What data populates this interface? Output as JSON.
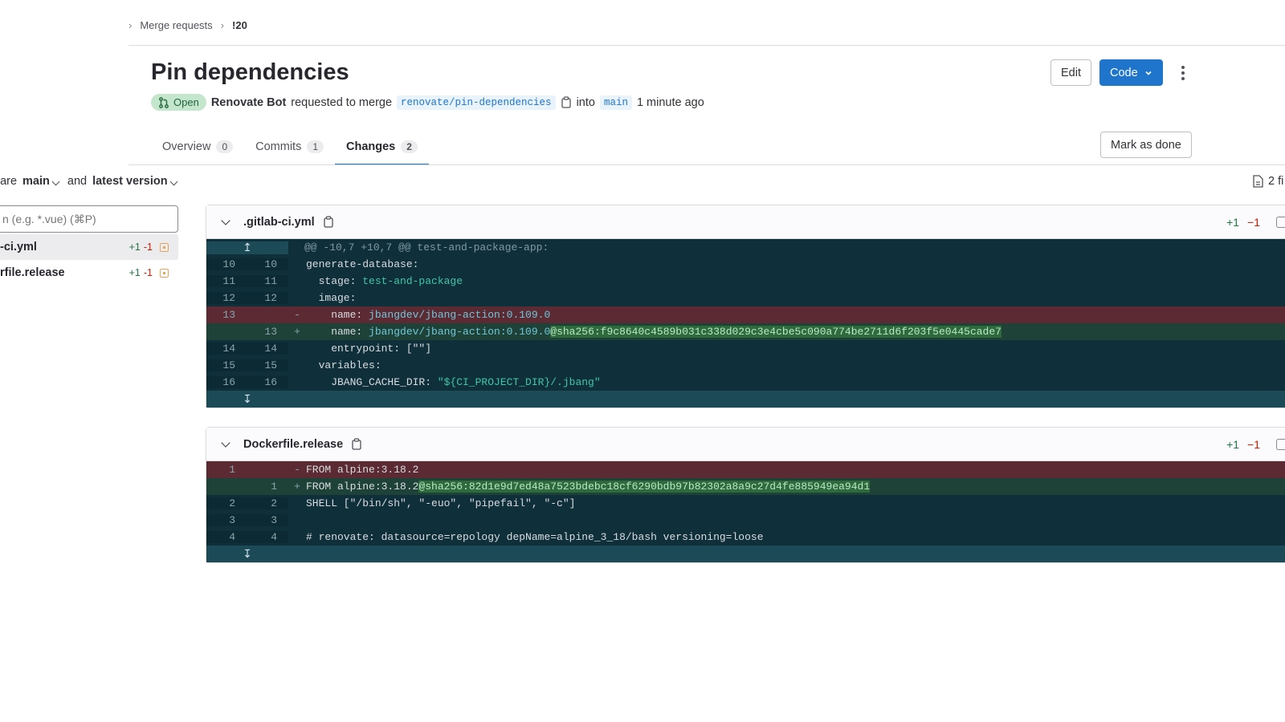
{
  "breadcrumb": {
    "item1": "Merge requests",
    "current": "!20"
  },
  "title": "Pin dependencies",
  "status": "Open",
  "author": "Renovate Bot",
  "request_text": "requested to merge",
  "source_branch": "renovate/pin-dependencies",
  "into_text": "into",
  "target_branch": "main",
  "time_ago": "1 minute ago",
  "actions": {
    "edit": "Edit",
    "code": "Code"
  },
  "tabs": [
    {
      "label": "Overview",
      "count": "0"
    },
    {
      "label": "Commits",
      "count": "1"
    },
    {
      "label": "Changes",
      "count": "2"
    }
  ],
  "mark_done": "Mark as done",
  "compare": {
    "prefix": "pare",
    "base": "main",
    "and": "and",
    "head": "latest version"
  },
  "files_count": "2 fi",
  "file_filter_placeholder": "n (e.g. *.vue) (⌘P)",
  "file_tree": [
    {
      "name": "-ci.yml",
      "add": "+1",
      "del": "-1"
    },
    {
      "name": "rfile.release",
      "add": "+1",
      "del": "-1"
    }
  ],
  "diffs": [
    {
      "filename": ".gitlab-ci.yml",
      "add": "+1",
      "del": "−1",
      "hunk": "@@ -10,7 +10,7 @@ test-and-package-app:",
      "lines": [
        {
          "old": "10",
          "new": "10",
          "mark": " ",
          "text": "generate-database:"
        },
        {
          "old": "11",
          "new": "11",
          "mark": " ",
          "text": "  stage: ",
          "value": "test-and-package"
        },
        {
          "old": "12",
          "new": "12",
          "mark": " ",
          "text": "  image:"
        },
        {
          "old": "13",
          "new": "",
          "mark": "-",
          "text": "    name: ",
          "value": "jbangdev/jbang-action:0.109.0"
        },
        {
          "old": "",
          "new": "13",
          "mark": "+",
          "text": "    name: ",
          "value": "jbangdev/jbang-action:0.109.0",
          "hl": "@sha256:f9c8640c4589b031c338d029c3e4cbe5c090a774be2711d6f203f5e0445cade7"
        },
        {
          "old": "14",
          "new": "14",
          "mark": " ",
          "text": "    entrypoint: [\"\"]"
        },
        {
          "old": "15",
          "new": "15",
          "mark": " ",
          "text": "  variables:"
        },
        {
          "old": "16",
          "new": "16",
          "mark": " ",
          "text": "    JBANG_CACHE_DIR: ",
          "str": "\"${CI_PROJECT_DIR}/.jbang\""
        }
      ]
    },
    {
      "filename": "Dockerfile.release",
      "add": "+1",
      "del": "−1",
      "lines": [
        {
          "old": "1",
          "new": "",
          "mark": "-",
          "text": "FROM alpine:3.18.2"
        },
        {
          "old": "",
          "new": "1",
          "mark": "+",
          "text": "FROM alpine:3.18.2",
          "hl": "@sha256:82d1e9d7ed48a7523bdebc18cf6290bdb97b82302a8a9c27d4fe885949ea94d1"
        },
        {
          "old": "2",
          "new": "2",
          "mark": " ",
          "text": "SHELL [\"/bin/sh\", \"-euo\", \"pipefail\", \"-c\"]"
        },
        {
          "old": "3",
          "new": "3",
          "mark": " ",
          "text": ""
        },
        {
          "old": "4",
          "new": "4",
          "mark": " ",
          "text": "# renovate: datasource=repology depName=alpine_3_18/bash versioning=loose"
        }
      ]
    }
  ],
  "colors": {
    "primary": "#1f75cb",
    "add": "#217645",
    "del": "#c91c00",
    "diff_bg": "#0f2f3a"
  }
}
